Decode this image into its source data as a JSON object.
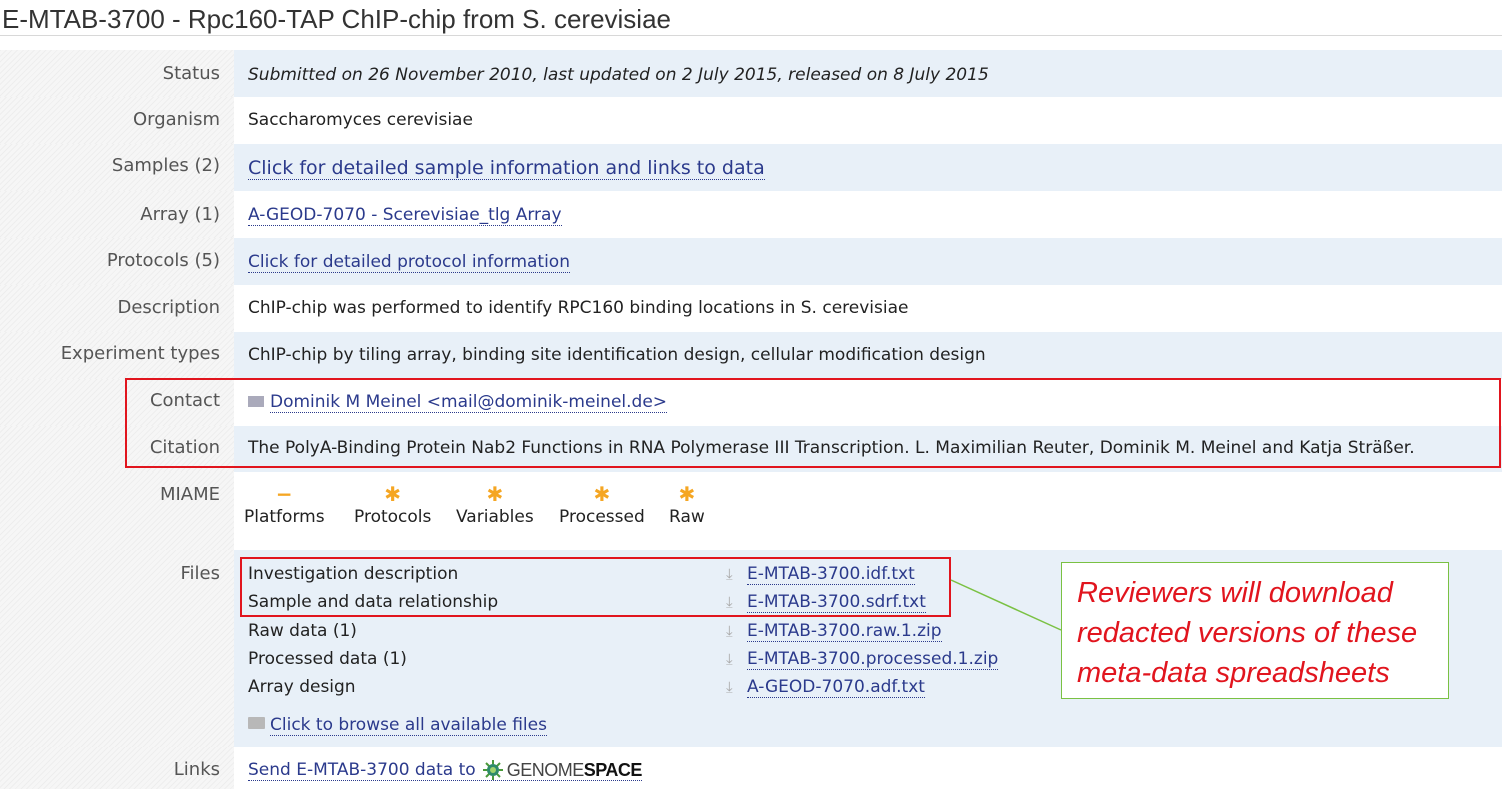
{
  "page": {
    "title": "E-MTAB-3700 - Rpc160-TAP ChIP-chip from S. cerevisiae"
  },
  "fields": {
    "status": {
      "label": "Status",
      "value": "Submitted on 26 November 2010, last updated on 2 July 2015, released on 8 July 2015"
    },
    "organism": {
      "label": "Organism",
      "value": "Saccharomyces cerevisiae"
    },
    "samples": {
      "label": "Samples (2)",
      "value": "Click for detailed sample information and links to data"
    },
    "array": {
      "label": "Array (1)",
      "value": "A-GEOD-7070 - Scerevisiae_tlg Array"
    },
    "protocols": {
      "label": "Protocols (5)",
      "value": "Click for detailed protocol information"
    },
    "description": {
      "label": "Description",
      "value": "ChIP-chip was performed to identify RPC160 binding locations in S. cerevisiae"
    },
    "experiment_types": {
      "label": "Experiment types",
      "value": "ChIP-chip by tiling array, binding site identification design, cellular modification design"
    },
    "contact": {
      "label": "Contact",
      "value": "Dominik M Meinel <mail@dominik-meinel.de>",
      "icon": "mail-icon"
    },
    "citation": {
      "label": "Citation",
      "value": "The PolyA-Binding Protein Nab2 Functions in RNA Polymerase III Transcription. L. Maximilian Reuter, Dominik M. Meinel and Katja Sträßer."
    },
    "miame": {
      "label": "MIAME",
      "items": [
        {
          "name": "Platforms",
          "mark": "−"
        },
        {
          "name": "Protocols",
          "mark": "✱"
        },
        {
          "name": "Variables",
          "mark": "✱"
        },
        {
          "name": "Processed",
          "mark": "✱"
        },
        {
          "name": "Raw",
          "mark": "✱"
        }
      ]
    },
    "files": {
      "label": "Files",
      "rows": [
        {
          "desc": "Investigation description",
          "file": "E-MTAB-3700.idf.txt"
        },
        {
          "desc": "Sample and data relationship",
          "file": "E-MTAB-3700.sdrf.txt"
        },
        {
          "desc": "Raw data (1)",
          "file": "E-MTAB-3700.raw.1.zip"
        },
        {
          "desc": "Processed data (1)",
          "file": "E-MTAB-3700.processed.1.zip"
        },
        {
          "desc": "Array design",
          "file": "A-GEOD-7070.adf.txt"
        }
      ],
      "browse": "Click to browse all available files"
    },
    "links": {
      "label": "Links",
      "value": "Send E-MTAB-3700 data to",
      "genome_prefix": "GENOME",
      "genome_suffix": "SPACE"
    }
  },
  "annotation": {
    "callout_text": "Reviewers will download redacted versions of these meta-data spreadsheets",
    "highlight_color": "#e1151e",
    "callout_border_color": "#7ac143"
  },
  "colors": {
    "link": "#2b3a8c",
    "row_shade": "#e8f0f8",
    "miame_star": "#f5a623"
  }
}
